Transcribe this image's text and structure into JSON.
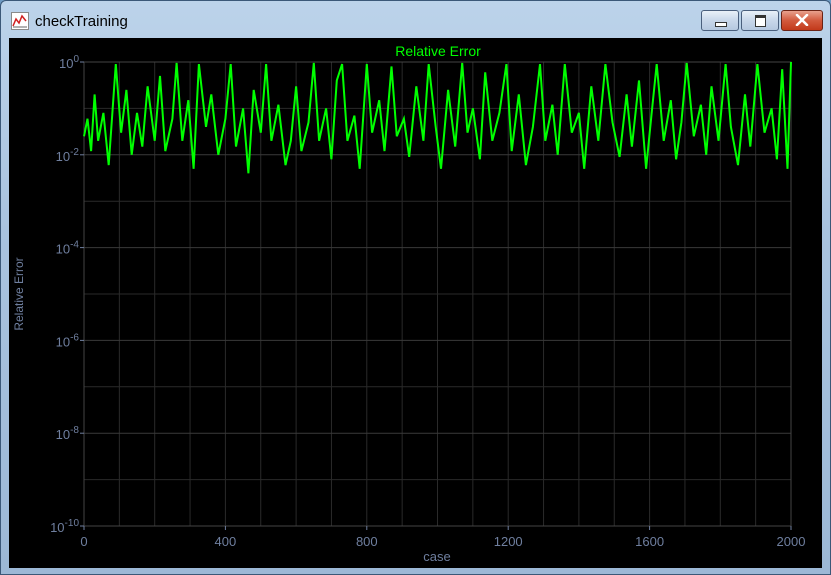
{
  "window": {
    "title": "checkTraining",
    "buttons": [
      "minimize",
      "maximize",
      "close"
    ]
  },
  "colors": {
    "series": "#00ff00",
    "axis_text": "#6f7f9f",
    "background": "#000000",
    "grid": "#2a2a2a"
  },
  "icons": {
    "app": "chart-app-icon",
    "minimize": "minimize-icon",
    "maximize": "maximize-icon",
    "close": "close-icon"
  },
  "chart_data": {
    "type": "line",
    "title": "Relative Error",
    "xlabel": "case",
    "ylabel": "Relative Error",
    "yscale": "log",
    "xlim": [
      0,
      2000
    ],
    "ylim": [
      1e-10,
      1
    ],
    "x_ticks": [
      "0",
      "400",
      "800",
      "1200",
      "1600",
      "2000"
    ],
    "y_ticks": [
      {
        "base": "10",
        "exp": "0"
      },
      {
        "base": "10",
        "exp": "-2"
      },
      {
        "base": "10",
        "exp": "-4"
      },
      {
        "base": "10",
        "exp": "-6"
      },
      {
        "base": "10",
        "exp": "-8"
      },
      {
        "base": "10",
        "exp": "-10"
      }
    ],
    "grid": true,
    "series": [
      {
        "color": "#00ff00",
        "points": [
          [
            0,
            0.025
          ],
          [
            10,
            0.06
          ],
          [
            20,
            0.012
          ],
          [
            30,
            0.2
          ],
          [
            40,
            0.02
          ],
          [
            55,
            0.08
          ],
          [
            70,
            0.006
          ],
          [
            90,
            0.9
          ],
          [
            105,
            0.03
          ],
          [
            120,
            0.25
          ],
          [
            135,
            0.01
          ],
          [
            150,
            0.08
          ],
          [
            165,
            0.015
          ],
          [
            180,
            0.3
          ],
          [
            200,
            0.02
          ],
          [
            215,
            0.5
          ],
          [
            230,
            0.012
          ],
          [
            250,
            0.06
          ],
          [
            262,
            0.95
          ],
          [
            278,
            0.02
          ],
          [
            295,
            0.15
          ],
          [
            310,
            0.005
          ],
          [
            325,
            0.9
          ],
          [
            345,
            0.04
          ],
          [
            360,
            0.2
          ],
          [
            380,
            0.01
          ],
          [
            400,
            0.06
          ],
          [
            415,
            0.9
          ],
          [
            430,
            0.015
          ],
          [
            450,
            0.1
          ],
          [
            465,
            0.004
          ],
          [
            480,
            0.25
          ],
          [
            500,
            0.03
          ],
          [
            515,
            0.9
          ],
          [
            530,
            0.02
          ],
          [
            550,
            0.12
          ],
          [
            570,
            0.006
          ],
          [
            585,
            0.02
          ],
          [
            600,
            0.3
          ],
          [
            615,
            0.012
          ],
          [
            635,
            0.05
          ],
          [
            650,
            0.95
          ],
          [
            665,
            0.02
          ],
          [
            685,
            0.1
          ],
          [
            700,
            0.008
          ],
          [
            715,
            0.4
          ],
          [
            730,
            0.9
          ],
          [
            745,
            0.02
          ],
          [
            765,
            0.07
          ],
          [
            780,
            0.005
          ],
          [
            800,
            0.9
          ],
          [
            815,
            0.03
          ],
          [
            835,
            0.15
          ],
          [
            850,
            0.012
          ],
          [
            870,
            0.8
          ],
          [
            885,
            0.025
          ],
          [
            905,
            0.06
          ],
          [
            920,
            0.009
          ],
          [
            940,
            0.3
          ],
          [
            960,
            0.02
          ],
          [
            975,
            0.9
          ],
          [
            995,
            0.04
          ],
          [
            1010,
            0.005
          ],
          [
            1030,
            0.25
          ],
          [
            1050,
            0.015
          ],
          [
            1070,
            0.95
          ],
          [
            1085,
            0.03
          ],
          [
            1100,
            0.1
          ],
          [
            1120,
            0.008
          ],
          [
            1135,
            0.6
          ],
          [
            1155,
            0.02
          ],
          [
            1175,
            0.08
          ],
          [
            1195,
            0.9
          ],
          [
            1210,
            0.012
          ],
          [
            1230,
            0.2
          ],
          [
            1250,
            0.006
          ],
          [
            1270,
            0.04
          ],
          [
            1290,
            0.9
          ],
          [
            1305,
            0.02
          ],
          [
            1325,
            0.12
          ],
          [
            1340,
            0.01
          ],
          [
            1360,
            0.9
          ],
          [
            1380,
            0.03
          ],
          [
            1400,
            0.08
          ],
          [
            1415,
            0.005
          ],
          [
            1435,
            0.3
          ],
          [
            1455,
            0.02
          ],
          [
            1475,
            0.9
          ],
          [
            1495,
            0.05
          ],
          [
            1515,
            0.009
          ],
          [
            1535,
            0.2
          ],
          [
            1550,
            0.015
          ],
          [
            1570,
            0.4
          ],
          [
            1590,
            0.005
          ],
          [
            1605,
            0.07
          ],
          [
            1620,
            0.9
          ],
          [
            1640,
            0.02
          ],
          [
            1660,
            0.15
          ],
          [
            1675,
            0.008
          ],
          [
            1690,
            0.05
          ],
          [
            1705,
            0.95
          ],
          [
            1725,
            0.025
          ],
          [
            1745,
            0.12
          ],
          [
            1760,
            0.01
          ],
          [
            1775,
            0.3
          ],
          [
            1795,
            0.02
          ],
          [
            1815,
            0.9
          ],
          [
            1830,
            0.04
          ],
          [
            1850,
            0.006
          ],
          [
            1870,
            0.2
          ],
          [
            1885,
            0.015
          ],
          [
            1905,
            0.9
          ],
          [
            1925,
            0.03
          ],
          [
            1945,
            0.1
          ],
          [
            1960,
            0.008
          ],
          [
            1975,
            0.7
          ],
          [
            1990,
            0.005
          ],
          [
            2000,
            1.0
          ]
        ]
      }
    ]
  }
}
